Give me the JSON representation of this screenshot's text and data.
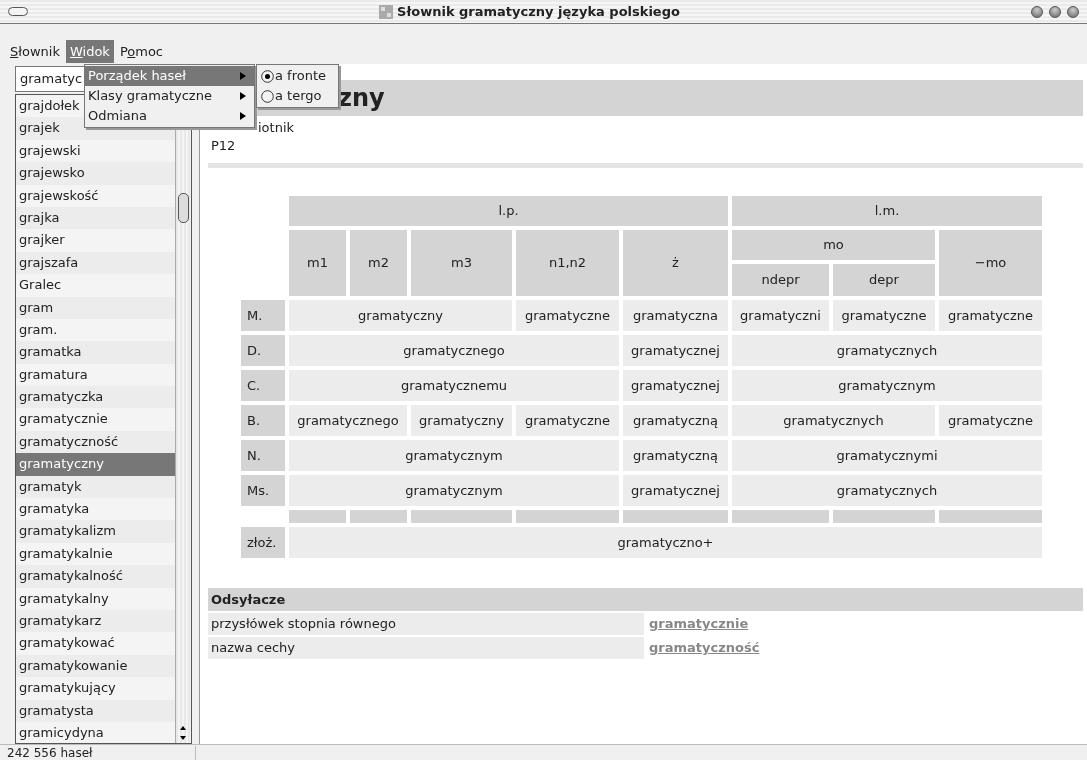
{
  "window": {
    "title": "Słownik gramatyczny języka polskiego"
  },
  "menu_bar": [
    {
      "key": "S",
      "post": "łownik",
      "selected": false
    },
    {
      "key": "W",
      "post": "idok",
      "selected": true
    },
    {
      "pre": "P",
      "key": "o",
      "post": "moc",
      "selected": false
    }
  ],
  "dropdown": [
    {
      "label": "Porządek haseł",
      "selected": true
    },
    {
      "label": "Klasy gramatyczne",
      "selected": false
    },
    {
      "label": "Odmiana",
      "selected": false
    }
  ],
  "submenu": [
    {
      "label": "a fronte",
      "selected": true
    },
    {
      "label": "a tergo",
      "selected": false
    }
  ],
  "search": {
    "value": "gramatyc"
  },
  "word_list": [
    {
      "text": "grajdołek",
      "selected": false
    },
    {
      "text": "grajek",
      "selected": false
    },
    {
      "text": "grajewski",
      "selected": false
    },
    {
      "text": "grajewsko",
      "selected": false
    },
    {
      "text": "grajewskość",
      "selected": false
    },
    {
      "text": "grajka",
      "selected": false
    },
    {
      "text": "grajker",
      "selected": false
    },
    {
      "text": "grajszafa",
      "selected": false
    },
    {
      "text": "Gralec",
      "selected": false
    },
    {
      "text": "gram",
      "selected": false
    },
    {
      "text": "gram.",
      "selected": false
    },
    {
      "text": "gramatka",
      "selected": false
    },
    {
      "text": "gramatura",
      "selected": false
    },
    {
      "text": "gramatyczka",
      "selected": false
    },
    {
      "text": "gramatycznie",
      "selected": false
    },
    {
      "text": "gramatyczność",
      "selected": false
    },
    {
      "text": "gramatyczny",
      "selected": true
    },
    {
      "text": "gramatyk",
      "selected": false
    },
    {
      "text": "gramatyka",
      "selected": false
    },
    {
      "text": "gramatykalizm",
      "selected": false
    },
    {
      "text": "gramatykalnie",
      "selected": false
    },
    {
      "text": "gramatykalność",
      "selected": false
    },
    {
      "text": "gramatykalny",
      "selected": false
    },
    {
      "text": "gramatykarz",
      "selected": false
    },
    {
      "text": "gramatykować",
      "selected": false
    },
    {
      "text": "gramatykowanie",
      "selected": false
    },
    {
      "text": "gramatykujący",
      "selected": false
    },
    {
      "text": "gramatysta",
      "selected": false
    },
    {
      "text": "gramicydyna",
      "selected": false
    }
  ],
  "status_bar": {
    "count": "242 556 haseł"
  },
  "entry": {
    "heading": "zny",
    "part_of_speech": "iotnik",
    "pattern": "P12"
  },
  "table": {
    "singular": "l.p.",
    "plural": "l.m.",
    "genders": [
      "m1",
      "m2",
      "m3",
      "n1,n2",
      "ż"
    ],
    "mo": "mo",
    "mo_sub": [
      "ndepr",
      "depr"
    ],
    "non_mo": "−mo",
    "rows": [
      {
        "case": "M.",
        "cells": [
          {
            "text": "gramatyczny",
            "colspan": 3
          },
          {
            "text": "gramatyczne"
          },
          {
            "text": "gramatyczna"
          },
          {
            "text": "gramatyczni"
          },
          {
            "text": "gramatyczne"
          },
          {
            "text": "gramatyczne"
          }
        ]
      },
      {
        "case": "D.",
        "cells": [
          {
            "text": "gramatycznego",
            "colspan": 4
          },
          {
            "text": "gramatycznej"
          },
          {
            "text": "gramatycznych",
            "colspan": 3
          }
        ]
      },
      {
        "case": "C.",
        "cells": [
          {
            "text": "gramatycznemu",
            "colspan": 4
          },
          {
            "text": "gramatycznej"
          },
          {
            "text": "gramatycznym",
            "colspan": 3
          }
        ]
      },
      {
        "case": "B.",
        "cells": [
          {
            "text": "gramatycznego",
            "colspan": 2
          },
          {
            "text": "gramatyczny"
          },
          {
            "text": "gramatyczne"
          },
          {
            "text": "gramatyczną"
          },
          {
            "text": "gramatycznych",
            "colspan": 2
          },
          {
            "text": "gramatyczne"
          }
        ]
      },
      {
        "case": "N.",
        "cells": [
          {
            "text": "gramatycznym",
            "colspan": 4
          },
          {
            "text": "gramatyczną"
          },
          {
            "text": "gramatycznymi",
            "colspan": 3
          }
        ]
      },
      {
        "case": "Ms.",
        "cells": [
          {
            "text": "gramatycznym",
            "colspan": 4
          },
          {
            "text": "gramatycznej"
          },
          {
            "text": "gramatycznych",
            "colspan": 3
          }
        ]
      }
    ],
    "compound": {
      "case": "złoż.",
      "text": "gramatyczno+"
    }
  },
  "references": {
    "title": "Odsyłacze",
    "rows": [
      {
        "label": "przysłówek stopnia równego",
        "link": "gramatycznie"
      },
      {
        "label": "nazwa cechy",
        "link": "gramatyczność"
      }
    ]
  }
}
